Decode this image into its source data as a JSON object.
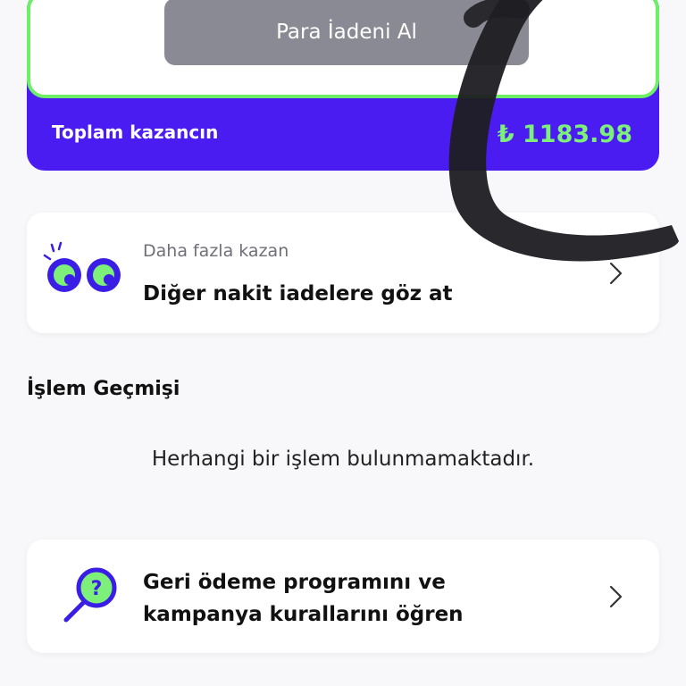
{
  "earnings": {
    "refund_button": "Para İadeni Al",
    "total_label": "Toplam kazancın",
    "total_amount": "₺ 1183.98"
  },
  "more_cashback": {
    "eyebrow": "Daha fazla kazan",
    "title": "Diğer nakit iadelere göz at",
    "icon": "eyes-icon"
  },
  "history": {
    "title": "İşlem Geçmişi",
    "empty_message": "Herhangi bir işlem bulunmamaktadır."
  },
  "rules": {
    "title": "Geri ödeme programını ve kampanya kurallarını öğren",
    "icon": "magnifier-question-icon"
  },
  "colors": {
    "brand": "#4a1cf2",
    "accent": "#6ef066",
    "amount": "#7df07a",
    "button_disabled": "#8a8a94"
  }
}
